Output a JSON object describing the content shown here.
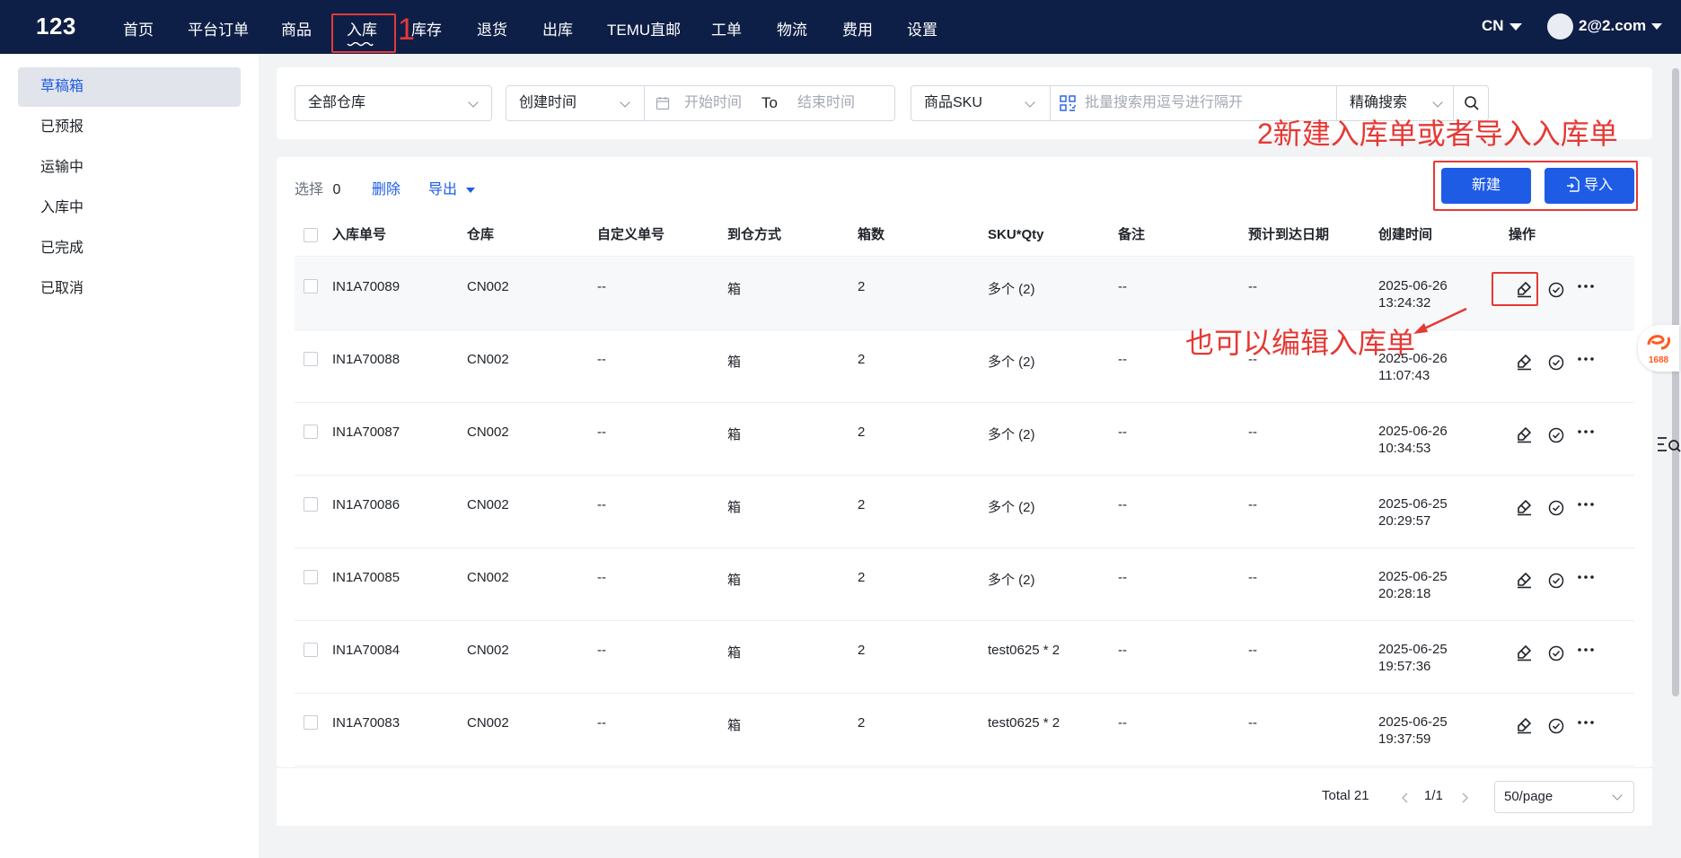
{
  "app": {
    "logo": "123"
  },
  "nav": {
    "items": [
      "首页",
      "平台订单",
      "商品",
      "入库",
      "库存",
      "退货",
      "出库",
      "TEMU直邮",
      "工单",
      "物流",
      "费用",
      "设置"
    ],
    "active": "入库",
    "language": "CN",
    "user": "2@2.com"
  },
  "sidebar": {
    "items": [
      "草稿箱",
      "已预报",
      "运输中",
      "入库中",
      "已完成",
      "已取消"
    ],
    "active": "草稿箱"
  },
  "filters": {
    "warehouse": "全部仓库",
    "date_type": "创建时间",
    "start_placeholder": "开始时间",
    "to_label": "To",
    "end_placeholder": "结束时间",
    "sku_type": "商品SKU",
    "search_placeholder": "批量搜索用逗号进行隔开",
    "search_mode": "精确搜索"
  },
  "toolbar": {
    "select_label": "选择",
    "select_count": "0",
    "delete_label": "删除",
    "export_label": "导出",
    "new_label": "新建",
    "import_label": "导入"
  },
  "table": {
    "columns": [
      "入库单号",
      "仓库",
      "自定义单号",
      "到仓方式",
      "箱数",
      "SKU*Qty",
      "备注",
      "预计到达日期",
      "创建时间",
      "操作"
    ],
    "rows": [
      {
        "id": "IN1A70089",
        "warehouse": "CN002",
        "custom": "--",
        "method": "箱",
        "boxes": "2",
        "sku": "多个 (2)",
        "sku_link": true,
        "note": "--",
        "eta": "--",
        "date": "2025-06-26",
        "time": "13:24:32"
      },
      {
        "id": "IN1A70088",
        "warehouse": "CN002",
        "custom": "--",
        "method": "箱",
        "boxes": "2",
        "sku": "多个 (2)",
        "sku_link": true,
        "note": "--",
        "eta": "--",
        "date": "2025-06-26",
        "time": "11:07:43"
      },
      {
        "id": "IN1A70087",
        "warehouse": "CN002",
        "custom": "--",
        "method": "箱",
        "boxes": "2",
        "sku": "多个 (2)",
        "sku_link": true,
        "note": "--",
        "eta": "--",
        "date": "2025-06-26",
        "time": "10:34:53"
      },
      {
        "id": "IN1A70086",
        "warehouse": "CN002",
        "custom": "--",
        "method": "箱",
        "boxes": "2",
        "sku": "多个 (2)",
        "sku_link": true,
        "note": "--",
        "eta": "--",
        "date": "2025-06-25",
        "time": "20:29:57"
      },
      {
        "id": "IN1A70085",
        "warehouse": "CN002",
        "custom": "--",
        "method": "箱",
        "boxes": "2",
        "sku": "多个 (2)",
        "sku_link": true,
        "note": "--",
        "eta": "--",
        "date": "2025-06-25",
        "time": "20:28:18"
      },
      {
        "id": "IN1A70084",
        "warehouse": "CN002",
        "custom": "--",
        "method": "箱",
        "boxes": "2",
        "sku": "test0625 * 2",
        "sku_link": false,
        "note": "--",
        "eta": "--",
        "date": "2025-06-25",
        "time": "19:57:36"
      },
      {
        "id": "IN1A70083",
        "warehouse": "CN002",
        "custom": "--",
        "method": "箱",
        "boxes": "2",
        "sku": "test0625 * 2",
        "sku_link": false,
        "note": "--",
        "eta": "--",
        "date": "2025-06-25",
        "time": "19:37:59"
      }
    ]
  },
  "pagination": {
    "total": "Total 21",
    "page": "1/1",
    "page_size": "50/page"
  },
  "annotations": {
    "step1": "1",
    "step2": "2新建入库单或者导入入库单",
    "edit_note": "也可以编辑入库单"
  },
  "widgets": {
    "badge": "1688"
  },
  "colors": {
    "nav_bg": "#0e1f47",
    "primary": "#1e5ce6",
    "annotation": "#e53935"
  },
  "icons": [
    "chevron-down-icon",
    "calendar-icon",
    "scan-icon",
    "search-icon",
    "import-icon",
    "edit-icon",
    "check-circle-icon",
    "more-icon",
    "search-list-icon"
  ]
}
